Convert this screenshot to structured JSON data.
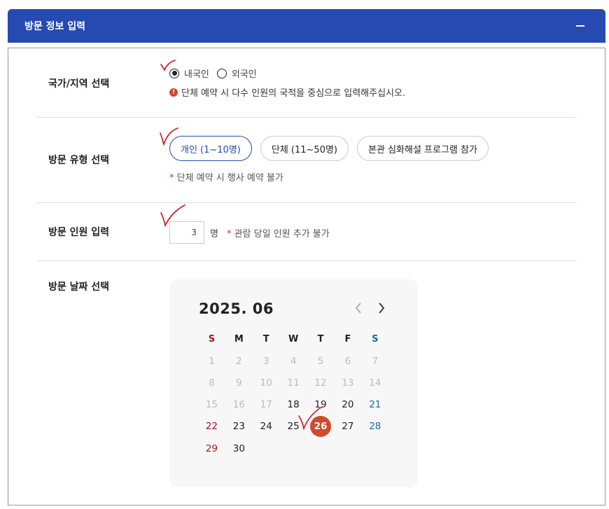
{
  "header": {
    "title": "방문 정보 입력"
  },
  "country": {
    "label": "국가/지역 선택",
    "options": [
      "내국인",
      "외국인"
    ],
    "selected": "내국인",
    "notice": "단체 예약 시 다수 인원의 국적을 중심으로 입력해주십시오.",
    "notice_icon": "!"
  },
  "visit_type": {
    "label": "방문 유형 선택",
    "options": [
      "개인 (1~10명)",
      "단체 (11~50명)",
      "본관 심화해설 프로그램 참가"
    ],
    "selected": "개인 (1~10명)",
    "note_star": "*",
    "note": " 단체 예약 시 행사 예약 불가"
  },
  "headcount": {
    "label": "방문 인원 입력",
    "value": "3",
    "unit": "명",
    "note_star": "*",
    "note": " 관람 당일 인원 추가 불가"
  },
  "date": {
    "label": "방문 날짜 선택",
    "calendar": {
      "title": "2025. 06",
      "weekdays": [
        "S",
        "M",
        "T",
        "W",
        "T",
        "F",
        "S"
      ],
      "weeks": [
        [
          "1",
          "2",
          "3",
          "4",
          "5",
          "6",
          "7"
        ],
        [
          "8",
          "9",
          "10",
          "11",
          "12",
          "13",
          "14"
        ],
        [
          "15",
          "16",
          "17",
          "18",
          "19",
          "20",
          "21"
        ],
        [
          "22",
          "23",
          "24",
          "25",
          "26",
          "27",
          "28"
        ],
        [
          "29",
          "30",
          "",
          "",
          "",
          "",
          ""
        ]
      ],
      "last_past_day": 17,
      "selected_day": "26"
    }
  },
  "colors": {
    "header_bg": "#264ab2",
    "accent_selected": "#d04a2b",
    "sunday": "#b0101e",
    "saturday": "#1c6ba8",
    "annotation": "#d0101e"
  }
}
